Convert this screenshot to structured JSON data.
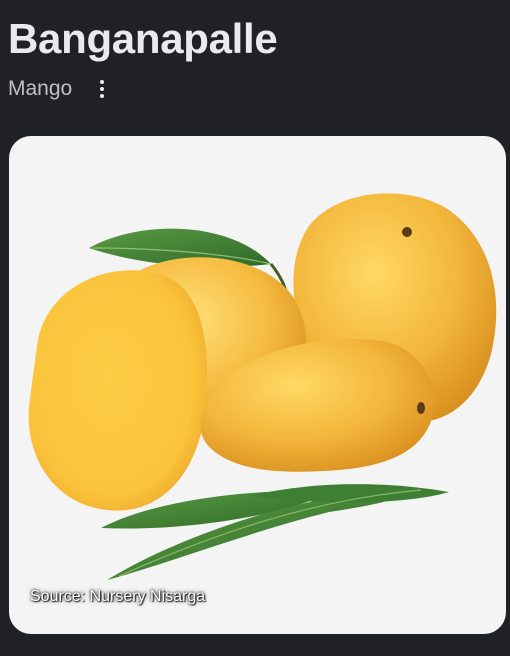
{
  "entity": {
    "title": "Banganapalle",
    "subtitle": "Mango"
  },
  "menu": {
    "icon": "more-vert-icon"
  },
  "image": {
    "caption": "Source: Nursery Nisarga",
    "background_color": "#f4f4f5",
    "fruit_color": "#f2b632",
    "leaf_color": "#3f7d33"
  }
}
